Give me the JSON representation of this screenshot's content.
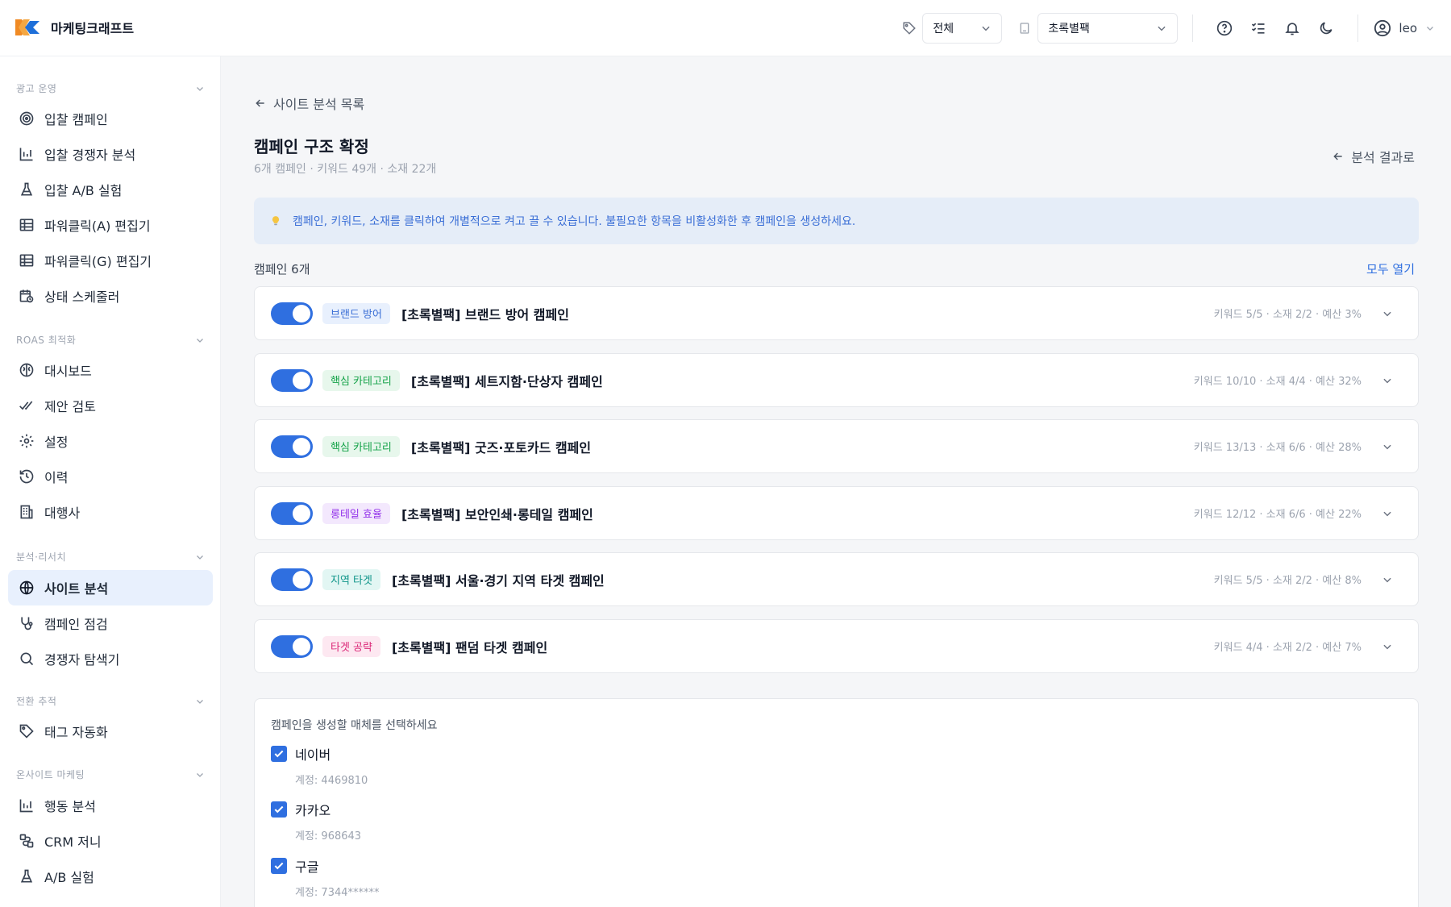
{
  "app": {
    "name": "마케팅크래프트"
  },
  "header": {
    "filter_select": "전체",
    "advertiser_select": "초록별팩",
    "user_name": "leo"
  },
  "sidebar": {
    "sections": [
      {
        "title": "광고 운영",
        "items": [
          {
            "label": "입찰 캠페인",
            "icon": "target-icon"
          },
          {
            "label": "입찰 경쟁자 분석",
            "icon": "chart-bar-icon"
          },
          {
            "label": "입찰 A/B 실험",
            "icon": "flask-icon"
          },
          {
            "label": "파워클릭(A) 편집기",
            "icon": "table-icon"
          },
          {
            "label": "파워클릭(G) 편집기",
            "icon": "table-icon"
          },
          {
            "label": "상태 스케줄러",
            "icon": "calendar-clock-icon"
          }
        ]
      },
      {
        "title": "ROAS 최적화",
        "items": [
          {
            "label": "대시보드",
            "icon": "brain-icon"
          },
          {
            "label": "제안 검토",
            "icon": "check-double-icon"
          },
          {
            "label": "설정",
            "icon": "gear-icon"
          },
          {
            "label": "이력",
            "icon": "history-icon"
          },
          {
            "label": "대행사",
            "icon": "building-icon"
          }
        ]
      },
      {
        "title": "분석·리서치",
        "items": [
          {
            "label": "사이트 분석",
            "icon": "globe-icon",
            "active": true
          },
          {
            "label": "캠페인 점검",
            "icon": "stethoscope-icon"
          },
          {
            "label": "경쟁자 탐색기",
            "icon": "search-icon"
          }
        ]
      },
      {
        "title": "전환 추적",
        "items": [
          {
            "label": "태그 자동화",
            "icon": "tag-icon"
          }
        ]
      },
      {
        "title": "온사이트 마케팅",
        "items": [
          {
            "label": "행동 분석",
            "icon": "chart-bar-icon"
          },
          {
            "label": "CRM 저니",
            "icon": "route-icon"
          },
          {
            "label": "A/B 실험",
            "icon": "flask-icon"
          }
        ]
      }
    ]
  },
  "main": {
    "back_label": "사이트 분석 목록",
    "title": "캠페인 구조 확정",
    "subtitle": "6개 캠페인 · 키워드 49개 · 소재 22개",
    "result_link": "분석 결과로",
    "info_text": "캠페인, 키워드, 소재를 클릭하여 개별적으로 켜고 끌 수 있습니다. 불필요한 항목을 비활성화한 후 캠페인을 생성하세요.",
    "campaign_count_label": "캠페인 6개",
    "open_all_label": "모두 열기",
    "campaigns": [
      {
        "badge": "브랜드 방어",
        "badge_color": "#3b6fd6",
        "badge_bg": "#e8f0fd",
        "name": "[초록별팩] 브랜드 방어 캠페인",
        "meta": "키워드 5/5 · 소재 2/2 · 예산 3%",
        "enabled": true
      },
      {
        "badge": "핵심 카테고리",
        "badge_color": "#16a34a",
        "badge_bg": "#e7f7ec",
        "name": "[초록별팩] 세트지함·단상자 캠페인",
        "meta": "키워드 10/10 · 소재 4/4 · 예산 32%",
        "enabled": true
      },
      {
        "badge": "핵심 카테고리",
        "badge_color": "#16a34a",
        "badge_bg": "#e7f7ec",
        "name": "[초록별팩] 굿즈·포토카드 캠페인",
        "meta": "키워드 13/13 · 소재 6/6 · 예산 28%",
        "enabled": true
      },
      {
        "badge": "롱테일 효율",
        "badge_color": "#9333ea",
        "badge_bg": "#f3e8fd",
        "name": "[초록별팩] 보안인쇄·롱테일 캠페인",
        "meta": "키워드 12/12 · 소재 6/6 · 예산 22%",
        "enabled": true
      },
      {
        "badge": "지역 타겟",
        "badge_color": "#0d9488",
        "badge_bg": "#e2f6f3",
        "name": "[초록별팩] 서울·경기 지역 타겟 캠페인",
        "meta": "키워드 5/5 · 소재 2/2 · 예산 8%",
        "enabled": true
      },
      {
        "badge": "타겟 공략",
        "badge_color": "#db2777",
        "badge_bg": "#fde8f1",
        "name": "[초록별팩] 팬덤 타겟 캠페인",
        "meta": "키워드 4/4 · 소재 2/2 · 예산 7%",
        "enabled": true
      }
    ],
    "media_title": "캠페인을 생성할 매체를 선택하세요",
    "media": [
      {
        "name": "네이버",
        "account": "계정: 4469810",
        "checked": true
      },
      {
        "name": "카카오",
        "account": "계정: 968643",
        "checked": true
      },
      {
        "name": "구글",
        "account": "계정: 7344******",
        "checked": true
      }
    ]
  },
  "colors": {
    "accent": "#2f6fe0",
    "active_bg": "#e8f0fd",
    "info_bg": "#e5edf8"
  }
}
